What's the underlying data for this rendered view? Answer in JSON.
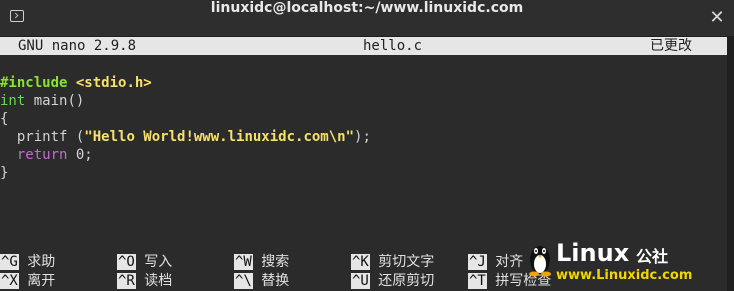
{
  "window": {
    "title": "linuxidc@localhost:~/www.linuxidc.com",
    "close_glyph": "✕"
  },
  "nano": {
    "version": "GNU nano 2.9.8",
    "filename": "hello.c",
    "status": "已更改"
  },
  "code": {
    "line1": {
      "directive": "#include",
      "header": "<stdio.h>"
    },
    "line2": {
      "type": "int",
      "rest": " main()"
    },
    "line3": "{",
    "line4": {
      "prefix": "  printf (",
      "string": "\"Hello World!www.linuxidc.com\\n\"",
      "suffix": ");"
    },
    "line5": {
      "indent": "  ",
      "keyword": "return",
      "rest": " 0;"
    },
    "line6": "}"
  },
  "shortcuts": [
    {
      "key": "^G",
      "label": "求助"
    },
    {
      "key": "^O",
      "label": "写入"
    },
    {
      "key": "^W",
      "label": "搜索"
    },
    {
      "key": "^K",
      "label": "剪切文字"
    },
    {
      "key": "^J",
      "label": "对齐"
    },
    {
      "key": "^X",
      "label": "离开"
    },
    {
      "key": "^R",
      "label": "读档"
    },
    {
      "key": "^\\",
      "label": "替换"
    },
    {
      "key": "^U",
      "label": "还原剪切"
    },
    {
      "key": "^T",
      "label": "拼写检查"
    }
  ],
  "watermark": {
    "brand": "Linux",
    "suffix": "公社",
    "url": "www.Linuxidc.com"
  },
  "colors": {
    "terminal_bg": "#2b2b2b",
    "nano_bar_bg": "#e6e6e6",
    "directive": "#8ae234",
    "string": "#f7e16a",
    "keyword_int": "#67d84e",
    "keyword_return": "#c06ecb",
    "watermark_url": "#f1d600"
  }
}
